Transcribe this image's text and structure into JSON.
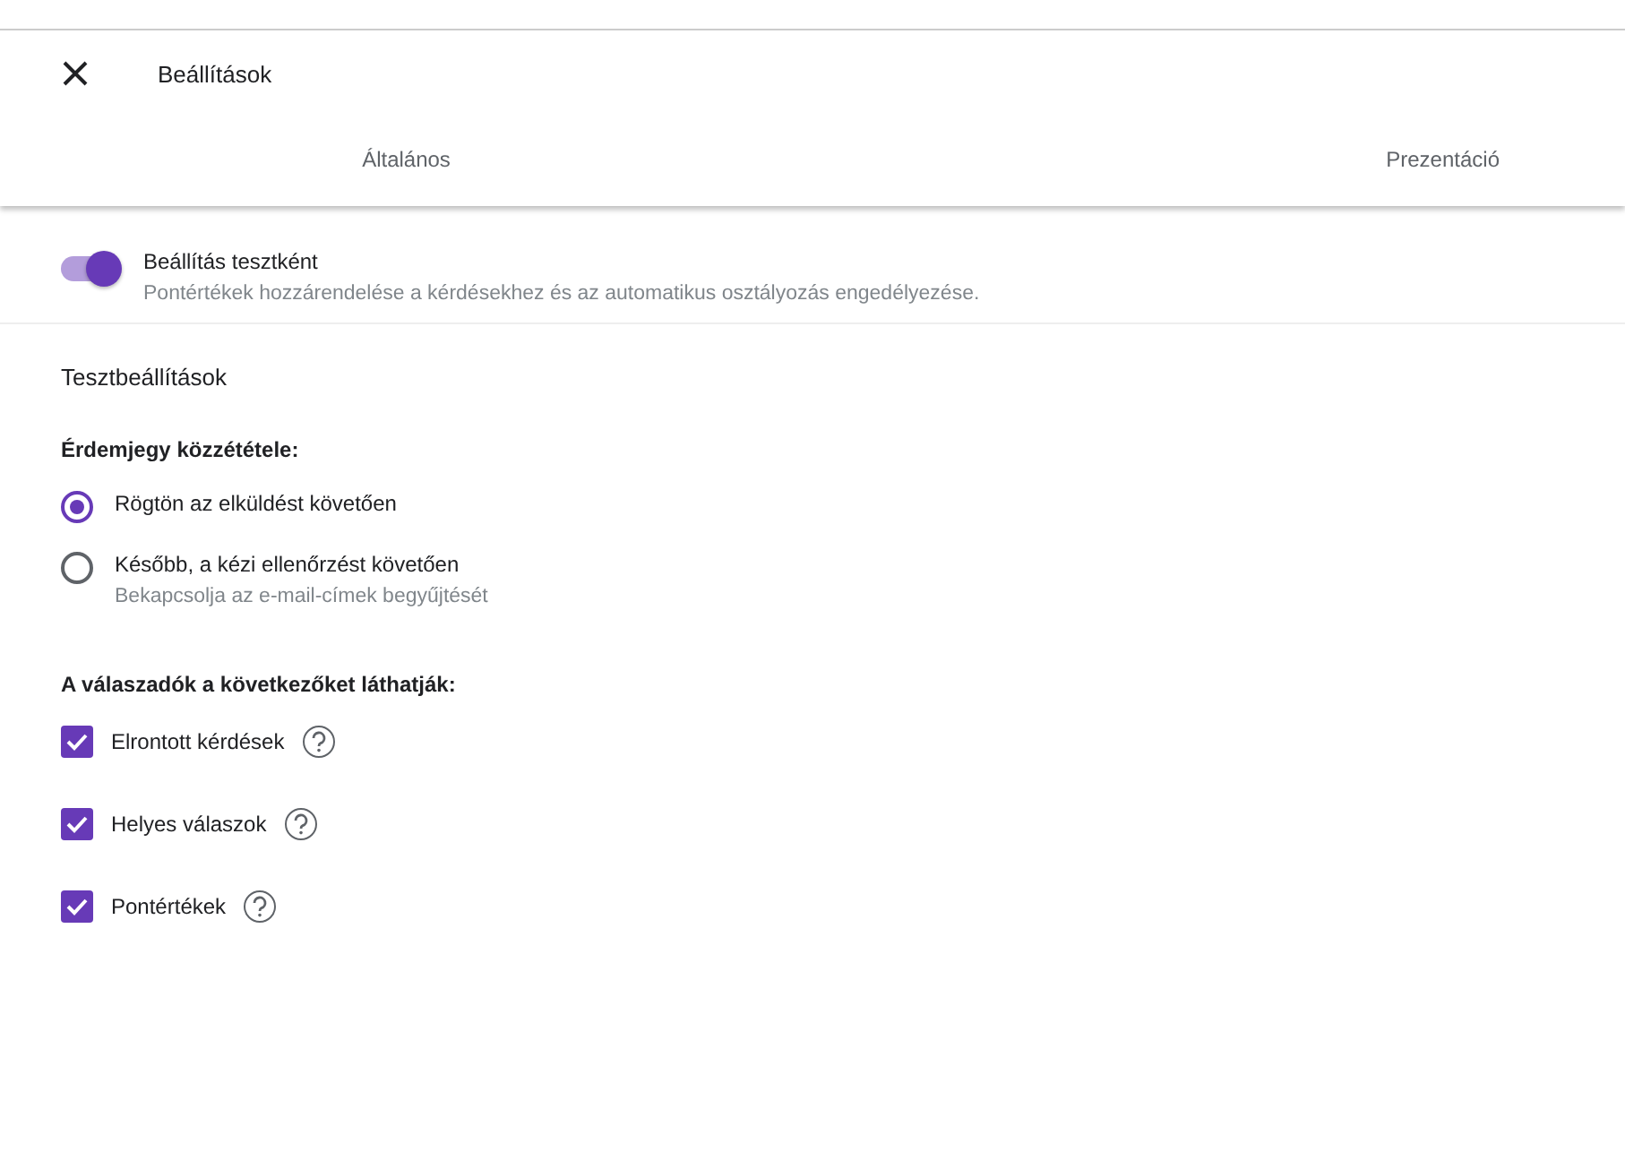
{
  "header": {
    "title": "Beállítások"
  },
  "tabs": [
    {
      "label": "Általános"
    },
    {
      "label": "Prezentáció"
    }
  ],
  "quiz_toggle": {
    "label": "Beállítás tesztként",
    "description": "Pontértékek hozzárendelése a kérdésekhez és az automatikus osztályozás engedélyezése.",
    "on": true
  },
  "section_title": "Tesztbeállítások",
  "release": {
    "heading": "Érdemjegy közzététele:",
    "options": [
      {
        "label": "Rögtön az elküldést követően",
        "selected": true
      },
      {
        "label": "Később, a kézi ellenőrzést követően",
        "hint": "Bekapcsolja az e-mail-címek begyűjtését",
        "selected": false
      }
    ]
  },
  "visibility": {
    "heading": "A válaszadók a következőket láthatják:",
    "options": [
      {
        "label": "Elrontott kérdések",
        "checked": true
      },
      {
        "label": "Helyes válaszok",
        "checked": true
      },
      {
        "label": "Pontértékek",
        "checked": true
      }
    ]
  }
}
